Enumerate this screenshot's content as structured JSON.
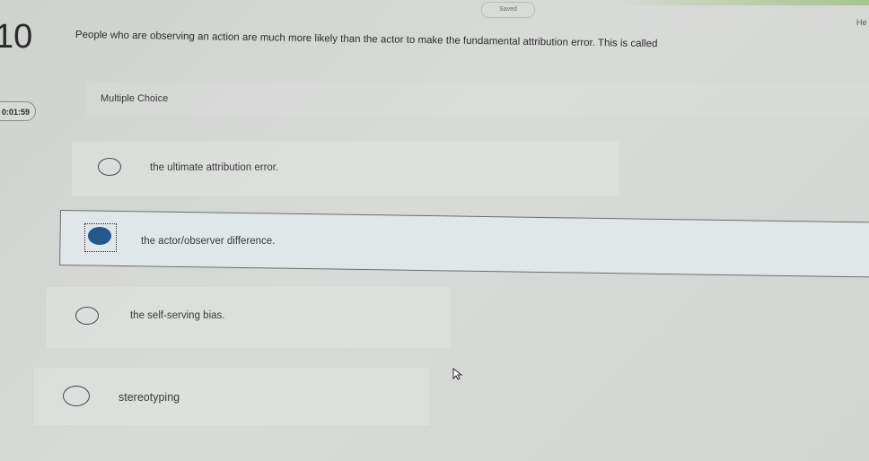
{
  "header": {
    "status_badge": "Saved",
    "help_label": "He"
  },
  "question": {
    "number": "10",
    "timer": "0:01:59",
    "text": "People who are observing an action are much more likely than the actor to make the fundamental attribution error. This is called",
    "type": "Multiple Choice"
  },
  "options": [
    {
      "label": "the ultimate attribution error.",
      "selected": false
    },
    {
      "label": "the actor/observer difference.",
      "selected": true
    },
    {
      "label": "the self-serving bias.",
      "selected": false
    },
    {
      "label": "stereotyping",
      "selected": false
    }
  ],
  "colors": {
    "selected_radio": "#24578f",
    "background": "#d3d5d2"
  },
  "icons": {
    "cursor": "mouse-pointer-icon"
  }
}
